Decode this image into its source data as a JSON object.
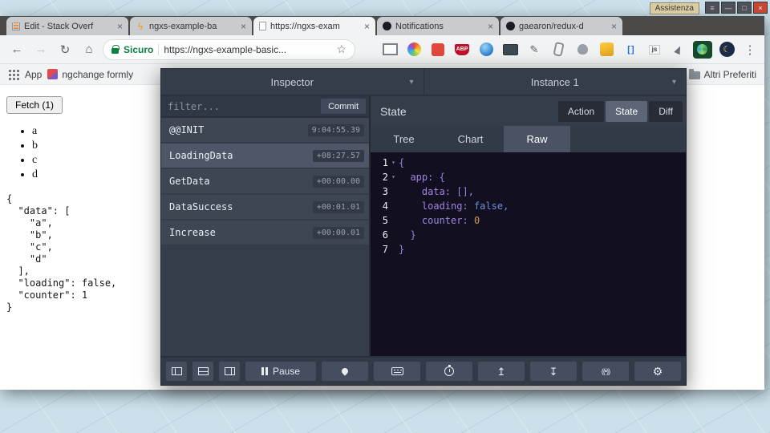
{
  "desktop": {
    "tooltip": "Assistenza"
  },
  "colors": {
    "secure_green": "#0B8043",
    "syntax": {
      "key": "#A183E3",
      "punct": "#8D88D8",
      "bool": "#6E8FD6",
      "num": "#D2984A"
    }
  },
  "browser": {
    "tabs": [
      {
        "label": "Edit - Stack Overf",
        "icon": "stackoverflow",
        "active": false
      },
      {
        "label": "ngxs-example-ba",
        "icon": "lightning",
        "active": false
      },
      {
        "label": "https://ngxs-exam",
        "icon": "document",
        "active": true
      },
      {
        "label": "Notifications",
        "icon": "github",
        "active": false
      },
      {
        "label": "gaearon/redux-d",
        "icon": "github",
        "active": false
      }
    ],
    "address_bar": {
      "secure_label": "Sicuro",
      "url": "https://ngxs-example-basic..."
    },
    "extensions": [
      {
        "name": "frame-capture",
        "label": ""
      },
      {
        "name": "color-wheel",
        "label": ""
      },
      {
        "name": "red-extension",
        "label": ""
      },
      {
        "name": "adblock",
        "label": "ABP"
      },
      {
        "name": "globe",
        "label": ""
      },
      {
        "name": "screenshot-dark",
        "label": ""
      },
      {
        "name": "pencil",
        "label": "✎"
      },
      {
        "name": "paperclip",
        "label": ""
      },
      {
        "name": "shield",
        "label": ""
      },
      {
        "name": "gold-badge",
        "label": ""
      },
      {
        "name": "brackets",
        "label": "[ ]"
      },
      {
        "name": "js-badge",
        "label": "js"
      },
      {
        "name": "cursor",
        "label": ""
      },
      {
        "name": "redux-devtools",
        "label": ""
      },
      {
        "name": "night-mode",
        "label": "☾"
      }
    ],
    "bookmarks_bar": {
      "apps_label": "App",
      "items": [
        {
          "label": "ngchange formly"
        }
      ],
      "other_label": "Altri Preferiti"
    }
  },
  "page": {
    "fetch_button": "Fetch (1)",
    "list_items": [
      "a",
      "b",
      "c",
      "d"
    ],
    "json_text": "{\n  \"data\": [\n    \"a\",\n    \"b\",\n    \"c\",\n    \"d\"\n  ],\n  \"loading\": false,\n  \"counter\": 1\n}"
  },
  "devtools": {
    "header": {
      "left_dropdown": "Inspector",
      "right_dropdown": "Instance 1"
    },
    "filter": {
      "placeholder": "filter...",
      "commit_label": "Commit"
    },
    "actions": [
      {
        "name": "@@INIT",
        "time": "9:04:55.39",
        "selected": false
      },
      {
        "name": "LoadingData",
        "time": "+08:27.57",
        "selected": true
      },
      {
        "name": "GetData",
        "time": "+00:00.00",
        "selected": false
      },
      {
        "name": "DataSuccess",
        "time": "+00:01.01",
        "selected": false
      },
      {
        "name": "Increase",
        "time": "+00:00.01",
        "selected": false
      }
    ],
    "state_panel": {
      "title": "State",
      "tabs": [
        {
          "label": "Action",
          "active": false
        },
        {
          "label": "State",
          "active": true
        },
        {
          "label": "Diff",
          "active": false
        }
      ],
      "subtabs": [
        {
          "label": "Tree",
          "active": false
        },
        {
          "label": "Chart",
          "active": false
        },
        {
          "label": "Raw",
          "active": true
        }
      ],
      "code": {
        "lines": [
          {
            "num": 1,
            "fold": true,
            "segments": [
              [
                "punct",
                "{"
              ]
            ]
          },
          {
            "num": 2,
            "fold": true,
            "segments": [
              [
                "plain",
                "  "
              ],
              [
                "key",
                "app:"
              ],
              [
                "plain",
                " "
              ],
              [
                "punct",
                "{"
              ]
            ]
          },
          {
            "num": 3,
            "fold": false,
            "segments": [
              [
                "plain",
                "    "
              ],
              [
                "key",
                "data:"
              ],
              [
                "plain",
                " "
              ],
              [
                "punct",
                "[],"
              ]
            ]
          },
          {
            "num": 4,
            "fold": false,
            "segments": [
              [
                "plain",
                "    "
              ],
              [
                "key",
                "loading:"
              ],
              [
                "plain",
                " "
              ],
              [
                "bool",
                "false"
              ],
              [
                "punct",
                ","
              ]
            ]
          },
          {
            "num": 5,
            "fold": false,
            "segments": [
              [
                "plain",
                "    "
              ],
              [
                "key",
                "counter:"
              ],
              [
                "plain",
                " "
              ],
              [
                "num",
                "0"
              ]
            ]
          },
          {
            "num": 6,
            "fold": false,
            "segments": [
              [
                "plain",
                "  "
              ],
              [
                "punct",
                "}"
              ]
            ]
          },
          {
            "num": 7,
            "fold": false,
            "segments": [
              [
                "punct",
                "}"
              ]
            ]
          }
        ]
      }
    },
    "toolbar": {
      "pause_label": "Pause"
    }
  }
}
